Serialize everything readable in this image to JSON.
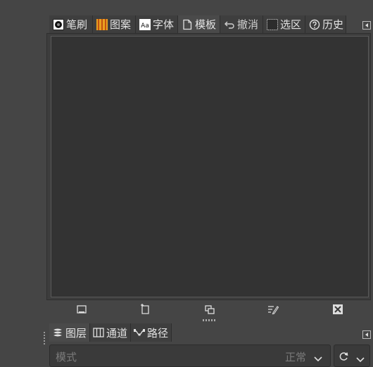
{
  "top_dock": {
    "tabs": [
      {
        "label": "笔刷",
        "icon": "brush-icon"
      },
      {
        "label": "图案",
        "icon": "pattern-icon"
      },
      {
        "label": "字体",
        "icon": "font-icon",
        "icon_text": "Aa"
      },
      {
        "label": "模板",
        "icon": "template-icon",
        "active": true
      },
      {
        "label": "撤消",
        "icon": "undo-icon"
      },
      {
        "label": "选区",
        "icon": "selection-icon"
      },
      {
        "label": "历史",
        "icon": "history-icon"
      }
    ],
    "toolbar_buttons": [
      "create-image-from-template-icon",
      "new-template-icon",
      "duplicate-template-icon",
      "edit-template-icon",
      "delete-template-icon"
    ]
  },
  "bottom_dock": {
    "tabs": [
      {
        "label": "图层",
        "icon": "layers-icon",
        "active": true
      },
      {
        "label": "通道",
        "icon": "channels-icon"
      },
      {
        "label": "路径",
        "icon": "paths-icon"
      }
    ],
    "mode_label": "模式",
    "mode_value": "正常"
  },
  "colors": {
    "background": "#454545",
    "panel": "#333333",
    "tab": "#3e3e3e",
    "tab_active": "#4a4a4a",
    "text": "#e2e2e2"
  }
}
